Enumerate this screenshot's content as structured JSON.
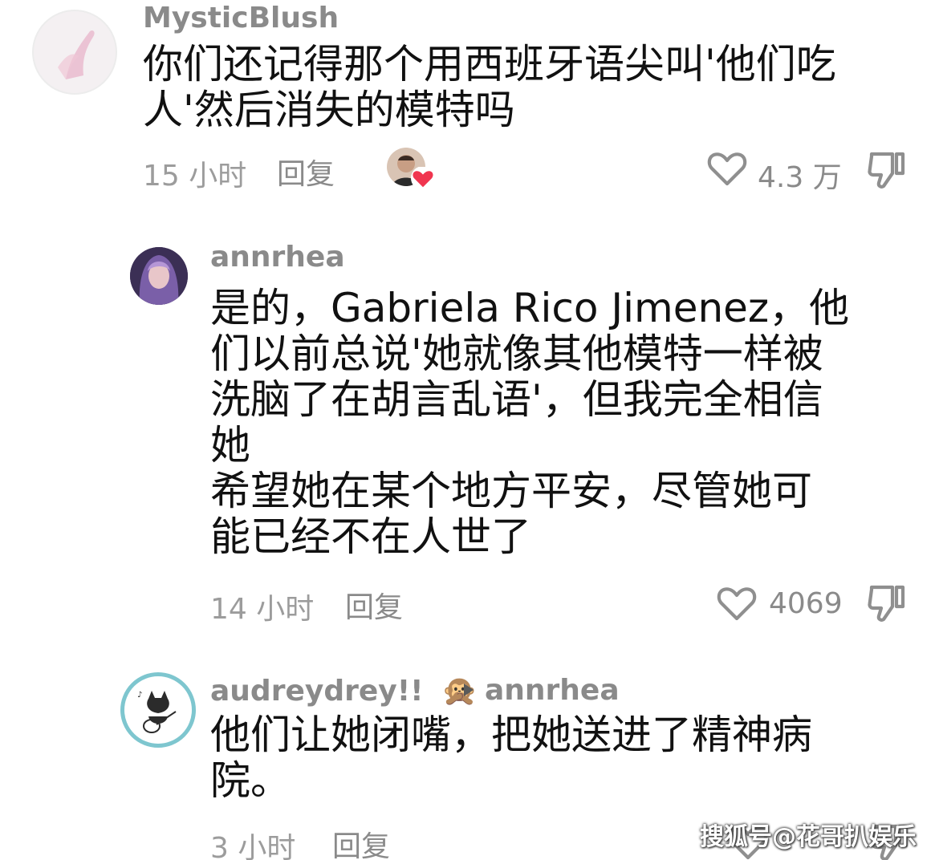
{
  "comments": [
    {
      "username": "MysticBlush",
      "text_lines": [
        "你们还记得那个用西班牙语尖叫'他们吃",
        "人'然后消失的模特吗"
      ],
      "time": "15 小时",
      "reply_label": "回复",
      "likes": "4.3 万",
      "creator_liked": true
    },
    {
      "username": "annrhea",
      "text_lines": [
        "是的，Gabriela Rico Jimenez，他",
        "们以前总说'她就像其他模特一样被",
        "洗脑了在胡言乱语'，但我完全相信",
        "她",
        "希望她在某个地方平安，尽管她可",
        "能已经不在人世了"
      ],
      "time": "14 小时",
      "reply_label": "回复",
      "likes": "4069"
    },
    {
      "username": "audreydrey!!",
      "emoji": "🙊",
      "reply_to": "annrhea",
      "text_lines": [
        "他们让她闭嘴，把她送进了精神病",
        "院。"
      ],
      "time": "3 小时",
      "reply_label": "回复"
    }
  ],
  "watermark": "搜狐号@花哥扒娱乐",
  "icons": {
    "like": "heart-outline-icon",
    "dislike": "thumbs-down-icon",
    "reply_arrow": "triangle-right-icon"
  },
  "colors": {
    "heart_red": "#f0354f",
    "muted_text": "#9c9c9c"
  }
}
